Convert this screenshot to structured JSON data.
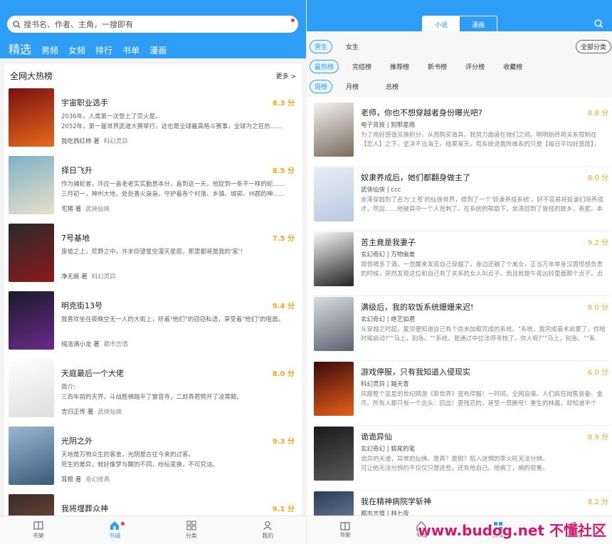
{
  "left": {
    "search_placeholder": "搜书名、作者、主角，一搜即有",
    "tabs": [
      "精选",
      "男频",
      "女频",
      "排行",
      "书单",
      "漫画"
    ],
    "section_title": "全网大热榜",
    "more": "更多 >",
    "books": [
      {
        "title": "宇宙职业选手",
        "score": "8.3 分",
        "desc": "2036年，人类第一次登上了荧火星。\n    2052年，第一届世界武道大赛举行，这也是全球最高格斗赛事，全球为之狂热……",
        "author": "我吃西红柿 著",
        "cat": "科幻灵异",
        "cover": [
          "#7a1010",
          "#e86a1a"
        ]
      },
      {
        "title": "择日飞升",
        "score": "8.5 分",
        "desc": "作为捕蛇者，许应一直老老实实勤恳本分，直到这一天，他捉到一条不一样的蛇……\n    三月初一，神州大地，处处香火袅袅，守护着各个村落、乡镇、城郭、州郡的神……",
        "author": "宅猪 著",
        "cat": "武侠仙侠",
        "cover": [
          "#7fb2c8",
          "#e8e0c8"
        ]
      },
      {
        "title": "7号基地",
        "score": "7.5 分",
        "desc": "废墟之上，荒野之中，许末仰望星空漫天星辰，那里都将是我的'家'！",
        "author": "净无痕 著",
        "cat": "科幻灵异",
        "cover": [
          "#2a2a2a",
          "#8a1a1a"
        ]
      },
      {
        "title": "明克街13号",
        "score": "9.4 分",
        "desc": "我喜欢坐在夜晚空无一人的大街上，听着\"他们\"的窃窃私语，享受着\"他们\"的喧嚣。",
        "author": "纯洁滴小龙 著",
        "cat": "都市言情",
        "cover": [
          "#1a1a2a",
          "#6a2a8a"
        ]
      },
      {
        "title": "天庭最后一个大佬",
        "score": "8.0 分",
        "desc": "简介:\n    三百年前的天界，斗战胜佛踏平了雷音寺，二郎真君劈开了凌霄殿。",
        "author": "言归正传 著",
        "cat": "武侠仙侠",
        "cover": [
          "#ffffff",
          "#dddddd"
        ]
      },
      {
        "title": "光阴之外",
        "score": "9.3 分",
        "desc": "天地是万物众生的客舍，光阴是古往今来的过客。\n    死生的差异，就好像梦与醒的不同，纷纭变换，不可究诘。",
        "author": "耳根 著",
        "cat": "奇幻修真",
        "cover": [
          "#9ab8d0",
          "#3a5a7a"
        ]
      },
      {
        "title": "我将埋葬众神",
        "score": "9.1 分",
        "desc": "",
        "author": "",
        "cat": "",
        "cover": [
          "#3a2a2a",
          "#8a5a3a"
        ]
      }
    ],
    "nav": [
      "书架",
      "书城",
      "分类",
      "我的"
    ]
  },
  "right": {
    "seg": [
      "小说",
      "漫画"
    ],
    "gender": [
      "男生",
      "女生"
    ],
    "all_cat": "全部分类",
    "rank_types": [
      "最热榜",
      "完结榜",
      "推荐榜",
      "新书榜",
      "评分榜",
      "收藏榜"
    ],
    "periods": [
      "周榜",
      "月榜",
      "总榜"
    ],
    "books": [
      {
        "title": "老师，你也不想穿越者身份曝光吧?",
        "score": "8.8 分",
        "meta": "电子竞技 | 别那星雨",
        "desc": "为了用好感值兑换积分，从而购买道具，我努力面疲在她们之间。明明始终将关系限制在【恋人】之下，坚决不当海王。结果某天，苟系统说我所维系的只是【每日平均好感度】，真实……",
        "cover": [
          "#f2f2f2",
          "#7a6a5a"
        ]
      },
      {
        "title": "奴隶养成后，她们都翻身做主了",
        "score": "8.0 分",
        "meta": "武侠仙侠 | ccc",
        "desc": "余泽穿越到了名为'上苍'的仙侠世界，得到了一个'奴隶养成系统'。好不容易将奴隶们培养成才，然后……他被其中一个人背刺了。在系统的帮助下，余泽回到了曾经的故乡，表星。本以……",
        "cover": [
          "#e8eef6",
          "#b8c8e0"
        ]
      },
      {
        "title": "苦主竟是我妻子",
        "score": "9.2 分",
        "meta": "玄幻奇幻 | 万物偷差",
        "desc": "周恒喝多了酒，一觉醒来发现自己穿越了，身边还躺了个美女，正当万年单身汉周恒想负责的时候，突然发现这位和自己有了关系的女人叫贞子。而且就是午夜凶铃里面那个贞子。贞子……",
        "cover": [
          "#f8f8f8",
          "#222222"
        ]
      },
      {
        "title": "满级后，我的软饭系统姗姗来迟!",
        "score": "6.0 分",
        "meta": "玄幻奇幻 | 绝艺如君",
        "desc": "从穿越之时起，夏宗便知道自己有个尚未加载完成的系统。\"系统，我完成衰术启蒙了，你啥时候启动?\"\"马上，别急。\"\"系统，我通过中位法师考核了，你人呢?\"\"马上，别急。\"\"系统，我善……",
        "cover": [
          "#d8dde4",
          "#5a6470"
        ]
      },
      {
        "title": "游戏停服，只有我知道入侵现实",
        "score": "6.0 分",
        "meta": "科幻灵异 | 踏天青",
        "desc": "风靡整个蓝星的世纪网游《新世界》宣布停服！一时间，全网哀嚎。人们疯狂抛售装备、金币。所有人都只有一个念头：回血！更残忍的，甚至一怒删号！重生的林晨，却知道半个月……",
        "cover": [
          "#3a0a0a",
          "#e8601a"
        ]
      },
      {
        "title": "诡诡异仙",
        "score": "8.9 分",
        "meta": "玄幻奇幻 | 狐尾的笔",
        "desc": "诡异的天道，异常的仙佛，是真？是假？陷入迷惘的李火旺无法分辨。\n    可让他无法分辨的不仅仅只是这些。还有他自己。他病了，病的很重。",
        "cover": [
          "#1a1a1a",
          "#5a5a5a"
        ]
      },
      {
        "title": "我在精神病院学斩神",
        "score": "8.2 分",
        "meta": "都市言情 | 林七夜",
        "desc": "",
        "cover": [
          "#2a3a5a",
          "#8a9ab0"
        ]
      }
    ],
    "nav": [
      "书架",
      "书城",
      "分类",
      "我的"
    ],
    "watermark": "www.budog.net 不懂社区"
  }
}
